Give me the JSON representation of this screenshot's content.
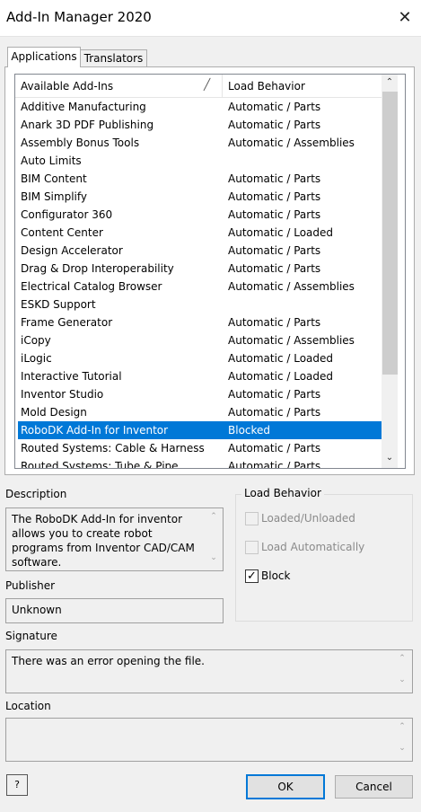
{
  "window": {
    "title": "Add-In Manager 2020",
    "close_glyph": "✕"
  },
  "tabs": [
    {
      "label": "Applications",
      "selected": true
    },
    {
      "label": "Translators",
      "selected": false
    }
  ],
  "list": {
    "columns": {
      "name": "Available Add-Ins",
      "sort_glyph": "╱",
      "behavior": "Load Behavior"
    },
    "rows": [
      {
        "name": "Additive Manufacturing",
        "behavior": "Automatic / Parts"
      },
      {
        "name": "Anark 3D PDF Publishing",
        "behavior": "Automatic / Parts"
      },
      {
        "name": "Assembly Bonus Tools",
        "behavior": "Automatic / Assemblies"
      },
      {
        "name": "Auto Limits",
        "behavior": ""
      },
      {
        "name": "BIM Content",
        "behavior": "Automatic / Parts"
      },
      {
        "name": "BIM Simplify",
        "behavior": "Automatic / Parts"
      },
      {
        "name": "Configurator 360",
        "behavior": "Automatic / Parts"
      },
      {
        "name": "Content Center",
        "behavior": "Automatic / Loaded"
      },
      {
        "name": "Design Accelerator",
        "behavior": "Automatic / Parts"
      },
      {
        "name": "Drag & Drop Interoperability",
        "behavior": "Automatic / Parts"
      },
      {
        "name": "Electrical Catalog Browser",
        "behavior": "Automatic / Assemblies"
      },
      {
        "name": "ESKD Support",
        "behavior": ""
      },
      {
        "name": "Frame Generator",
        "behavior": "Automatic / Parts"
      },
      {
        "name": "iCopy",
        "behavior": "Automatic / Assemblies"
      },
      {
        "name": "iLogic",
        "behavior": "Automatic / Loaded"
      },
      {
        "name": "Interactive Tutorial",
        "behavior": "Automatic / Loaded"
      },
      {
        "name": "Inventor Studio",
        "behavior": "Automatic / Parts"
      },
      {
        "name": "Mold Design",
        "behavior": "Automatic / Parts"
      },
      {
        "name": "RoboDK Add-In for Inventor",
        "behavior": "Blocked",
        "selected": true
      },
      {
        "name": "Routed Systems: Cable & Harness",
        "behavior": "Automatic / Parts"
      },
      {
        "name": "Routed Systems: Tube & Pipe",
        "behavior": "Automatic / Parts"
      }
    ],
    "scroll_up_glyph": "⌃",
    "scroll_down_glyph": "⌄"
  },
  "description": {
    "label": "Description",
    "text": "The RoboDK Add-In for inventor allows you to create robot programs from Inventor CAD/CAM software."
  },
  "publisher": {
    "label": "Publisher",
    "value": "Unknown"
  },
  "signature": {
    "label": "Signature",
    "value": "There was an error opening the file."
  },
  "location": {
    "label": "Location",
    "value": ""
  },
  "load_behavior": {
    "title": "Load Behavior",
    "options": [
      {
        "label": "Loaded/Unloaded",
        "checked": false,
        "enabled": false
      },
      {
        "label": "Load Automatically",
        "checked": false,
        "enabled": false
      },
      {
        "label": "Block",
        "checked": true,
        "enabled": true
      }
    ],
    "check_glyph": "✓"
  },
  "buttons": {
    "ok": "OK",
    "cancel": "Cancel",
    "help_glyph": "?"
  },
  "colors": {
    "selection": "#0078d7",
    "ok_border": "#0078d7"
  }
}
